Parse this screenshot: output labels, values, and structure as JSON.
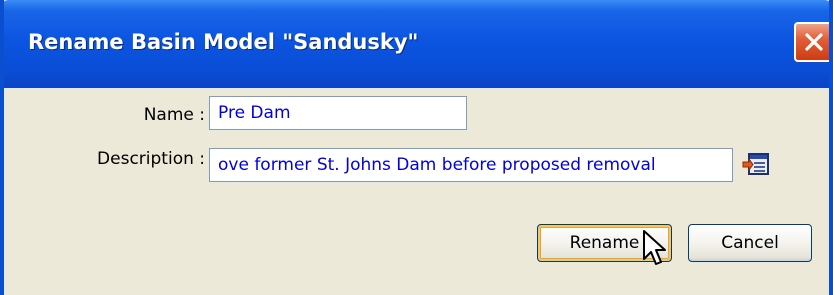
{
  "dialog": {
    "title": "Rename Basin Model \"Sandusky\"",
    "close_icon": "close-icon"
  },
  "form": {
    "name_label": "Name :",
    "name_value": "Pre Dam",
    "description_label": "Description :",
    "description_value": "ove former St. Johns Dam before proposed removal",
    "description_editor_icon": "description-editor-icon"
  },
  "buttons": {
    "rename_label": "Rename",
    "cancel_label": "Cancel"
  },
  "colors": {
    "titlebar": "#0b55e0",
    "client_background": "#ece9d8",
    "field_text": "#0000e0",
    "close_button": "#d9471e"
  }
}
